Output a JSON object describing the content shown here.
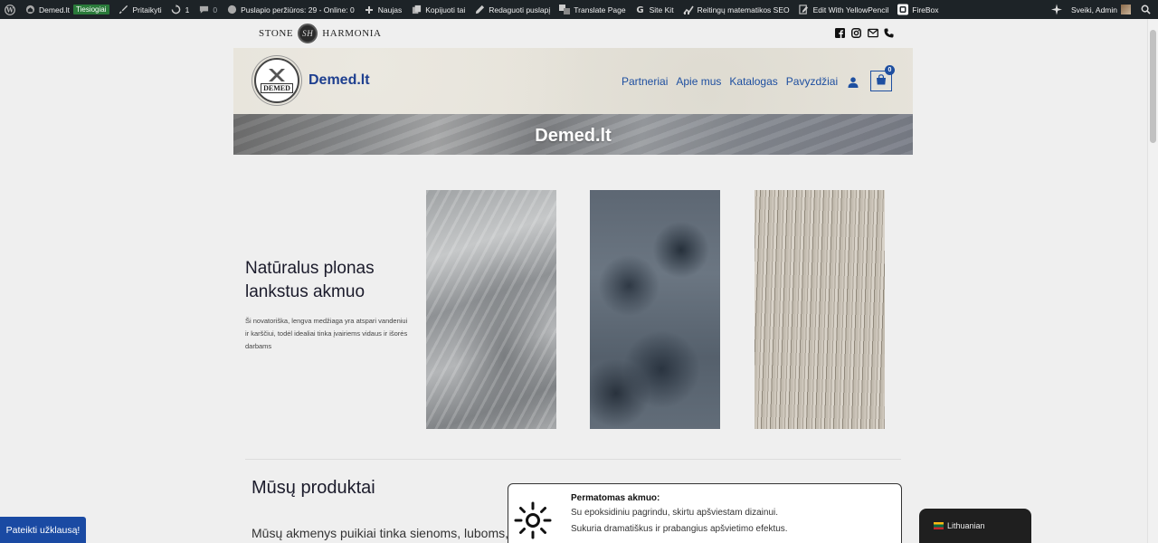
{
  "adminbar": {
    "site": "Demed.lt",
    "live_badge": "Tiesiogiai",
    "customize": "Pritaikyti",
    "updates_count": "1",
    "comments_count": "0",
    "pageviews": "Puslapio peržiūros: 29 - Online: 0",
    "new": "Naujas",
    "copy": "Kopijuoti tai",
    "edit": "Redaguoti puslapį",
    "translate": "Translate Page",
    "sitekit": "Site Kit",
    "seo": "Reitingų matematikos SEO",
    "yellowpencil": "Edit With YellowPencil",
    "firebox": "FireBox",
    "greeting": "Sveiki, Admin"
  },
  "topstrip": {
    "brand_left": "STONE",
    "brand_seal": "SH",
    "brand_right": "HARMONIA",
    "social_icons": [
      "facebook-icon",
      "instagram-icon",
      "mail-icon",
      "phone-icon"
    ]
  },
  "header": {
    "logo_text": "DEMED",
    "site_name": "Demed.lt",
    "nav": [
      "Partneriai",
      "Apie mus",
      "Katalogas",
      "Pavyzdžiai"
    ],
    "cart_count": "0"
  },
  "banner": {
    "title": "Demed.lt"
  },
  "intro": {
    "heading": "Natūralus plonas lankstus akmuo",
    "text": "Ši novatoriška, lengva medžiaga yra atspari vandeniui ir karščiui, todėl idealiai tinka įvairiems vidaus ir išorės darbams"
  },
  "products": {
    "heading": "Mūsų produktai",
    "text": "Mūsų akmenys puikiai tinka sienoms, luboms,"
  },
  "card": {
    "title": "Permatomas akmuo:",
    "line1": "Su epoksidiniu pagrindu, skirtu apšviestam dizainui.",
    "line2": "Sukuria dramatiškus ir prabangius apšvietimo efektus."
  },
  "inquiry_button": "Pateikti užklausą!",
  "language": "Lithuanian",
  "colors": {
    "brand_blue": "#1e4fa0",
    "admin_bar": "#1d2327"
  }
}
